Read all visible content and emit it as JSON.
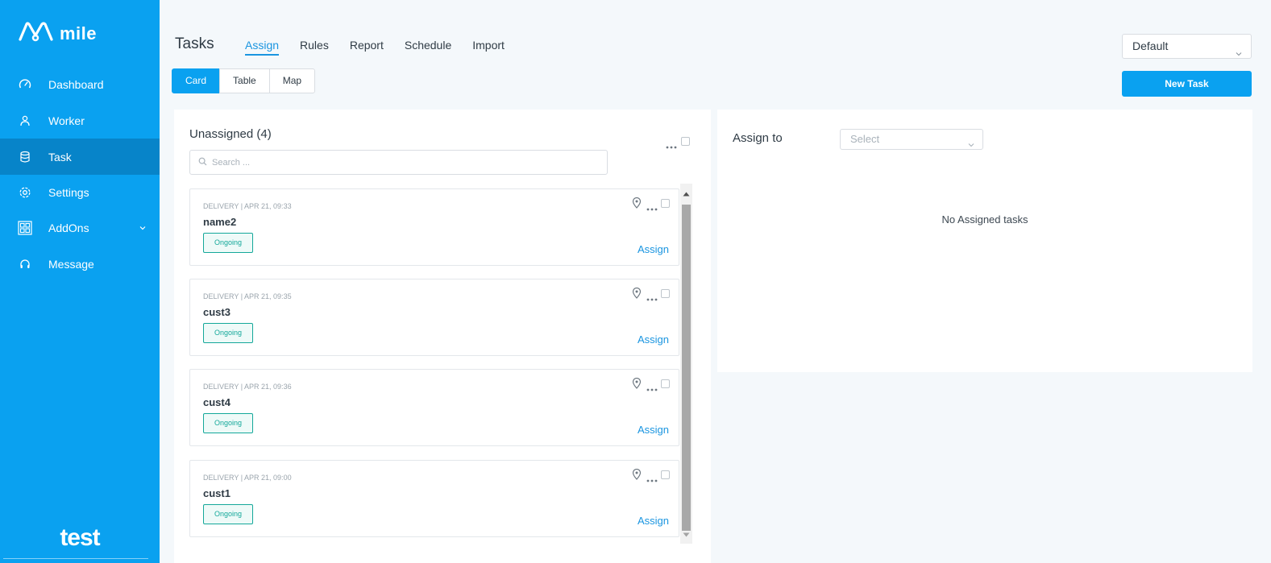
{
  "brand": {
    "name": "mile",
    "footer": "test"
  },
  "sidebar": {
    "items": [
      {
        "label": "Dashboard",
        "icon": "speedometer-icon"
      },
      {
        "label": "Worker",
        "icon": "worker-icon"
      },
      {
        "label": "Task",
        "icon": "database-icon",
        "active": true
      },
      {
        "label": "Settings",
        "icon": "gear-icon"
      },
      {
        "label": "AddOns",
        "icon": "addons-grid-icon",
        "expandable": true
      },
      {
        "label": "Message",
        "icon": "headset-icon"
      }
    ]
  },
  "header": {
    "title": "Tasks",
    "tabs": [
      {
        "label": "Assign",
        "active": true
      },
      {
        "label": "Rules"
      },
      {
        "label": "Report"
      },
      {
        "label": "Schedule"
      },
      {
        "label": "Import"
      }
    ],
    "view_modes": [
      {
        "label": "Card",
        "active": true
      },
      {
        "label": "Table"
      },
      {
        "label": "Map"
      }
    ],
    "filter_select": "Default",
    "new_task_label": "New Task"
  },
  "unassigned": {
    "title": "Unassigned (4)",
    "search_placeholder": "Search ...",
    "tasks": [
      {
        "meta": "DELIVERY | APR 21, 09:33",
        "name": "name2",
        "status": "Ongoing",
        "action": "Assign"
      },
      {
        "meta": "DELIVERY | APR 21, 09:35",
        "name": "cust3",
        "status": "Ongoing",
        "action": "Assign"
      },
      {
        "meta": "DELIVERY | APR 21, 09:36",
        "name": "cust4",
        "status": "Ongoing",
        "action": "Assign"
      },
      {
        "meta": "DELIVERY | APR 21, 09:00",
        "name": "cust1",
        "status": "Ongoing",
        "action": "Assign"
      }
    ]
  },
  "assign_panel": {
    "label": "Assign to",
    "select_placeholder": "Select",
    "empty_text": "No Assigned tasks"
  },
  "colors": {
    "primary": "#0aa1f0",
    "sidebar_active": "#0784c9",
    "status_ongoing": "#14a89a",
    "link": "#1a95e0"
  }
}
